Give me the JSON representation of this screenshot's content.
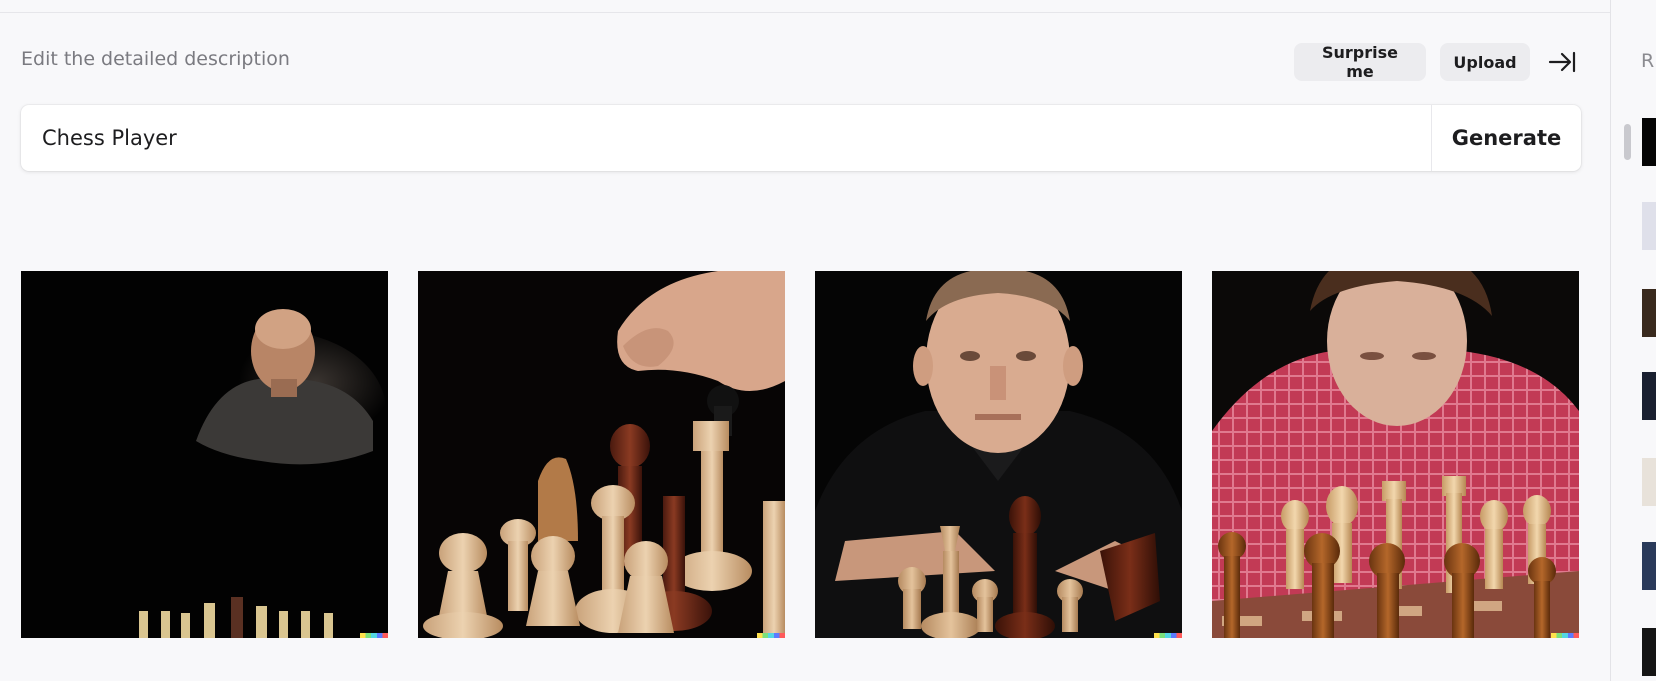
{
  "header": {
    "hint": "Edit the detailed description",
    "surprise_label": "Surprise me",
    "upload_label": "Upload"
  },
  "prompt": {
    "value": "Chess Player",
    "generate_label": "Generate"
  },
  "results": [
    {
      "alt": "Man leaning over chessboard in darkness"
    },
    {
      "alt": "Hand moving chess piece closeup"
    },
    {
      "alt": "Man in black shirt behind chess pieces"
    },
    {
      "alt": "Young man in red checked shirt at chessboard"
    }
  ],
  "sidebar": {
    "title": "R"
  },
  "colors": {
    "background": "#f8f8fa",
    "button_bg": "#ececef",
    "text_primary": "#1d1d1f",
    "text_muted": "#7a7a80"
  }
}
